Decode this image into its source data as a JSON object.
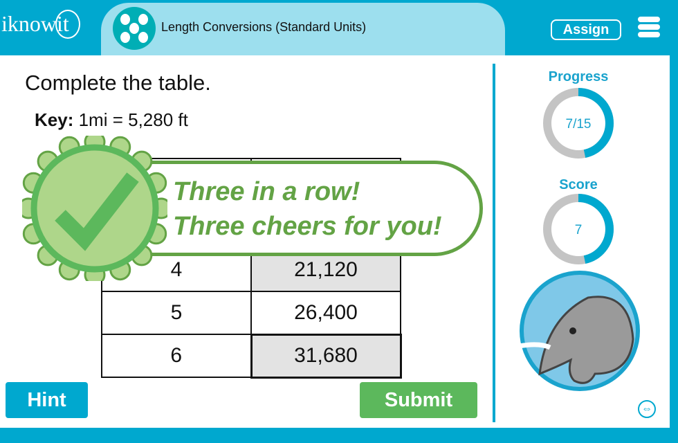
{
  "header": {
    "logo": "iknowit",
    "title": "Length Conversions (Standard Units)",
    "assign_label": "Assign",
    "icon": "lesson-dots-icon"
  },
  "question": {
    "prompt": "Complete the table.",
    "key_label": "Key:",
    "key_value": " 1mi = 5,280 ft"
  },
  "table": {
    "rows": [
      {
        "mi": "4",
        "ft": "21,120"
      },
      {
        "mi": "5",
        "ft": "26,400"
      },
      {
        "mi": "6",
        "ft": "31,680"
      }
    ]
  },
  "feedback": {
    "line1": "Three in a row!",
    "line2": "Three cheers for you!",
    "icon": "checkmark-badge-icon"
  },
  "buttons": {
    "hint": "Hint",
    "submit": "Submit"
  },
  "sidebar": {
    "progress_label": "Progress",
    "progress_value": "7/15",
    "progress_fraction": 0.467,
    "score_label": "Score",
    "score_value": "7",
    "score_fraction": 0.467
  },
  "colors": {
    "brand": "#00a8cf",
    "success": "#63a345",
    "submit": "#5cb85c",
    "ring_track": "#c4c4c4"
  }
}
